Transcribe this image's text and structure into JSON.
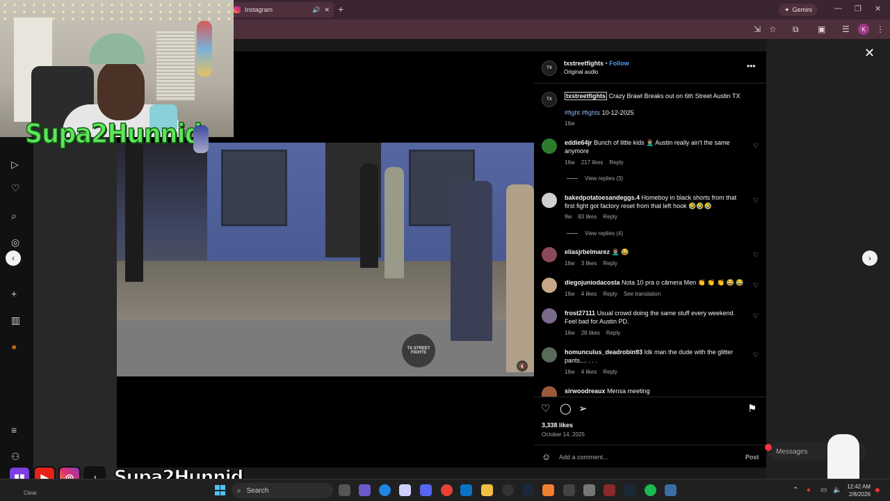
{
  "browser": {
    "tab_title": "Instagram",
    "new_tab": "+",
    "gemini_label": "Gemini",
    "profile_initial": "K",
    "window_controls": [
      "—",
      "❐",
      "✕"
    ]
  },
  "post": {
    "author": "txstreetfights",
    "follow_label": "Follow",
    "audio": "Original audio",
    "avatar_text": "TX",
    "caption_author": "txstreetfights",
    "caption_text": "Crazy Brawl Breaks out on 6th Street Austin TX",
    "hashtags": "#fight #fights",
    "caption_date": "10-12-2025",
    "caption_age": "16w",
    "video_logo_text": "TX STREET FIGHTS",
    "likes": "3,338 likes",
    "date": "October 14, 2025",
    "comment_placeholder": "Add a comment...",
    "post_label": "Post"
  },
  "comments": [
    {
      "user": "eddie64jr",
      "text": "Bunch of little kids 🤦🏽‍♂️ Austin really ain't the same anymore",
      "age": "16w",
      "likes": "217 likes",
      "reply": "Reply",
      "view_replies": "View replies (3)",
      "avatar_color": "#2e7a2e"
    },
    {
      "user": "bakedpotatoesandeggs.4",
      "text": "Homeboy in black shorts from that first fight got factory reset from that left hook 🤣🤣🤣",
      "age": "9w",
      "likes": "83 likes",
      "reply": "Reply",
      "view_replies": "View replies (4)",
      "avatar_color": "#cfcfcf"
    },
    {
      "user": "eliasjrbelmarez",
      "text": "🤦🏽‍♂️ 😂",
      "age": "16w",
      "likes": "3 likes",
      "reply": "Reply",
      "avatar_color": "#8a4a5a"
    },
    {
      "user": "diegojuniodacosta",
      "text": "Nota 10 pra o câmera Men 👏 👏 👏 😂 😂",
      "age": "16w",
      "likes": "4 likes",
      "reply": "Reply",
      "translate": "See translation",
      "avatar_color": "#c7a88a"
    },
    {
      "user": "frost27111",
      "text": "Usual crowd doing the same stuff every weekend. Feel bad for Austin PD.",
      "age": "16w",
      "likes": "28 likes",
      "reply": "Reply",
      "avatar_color": "#7a6a8a"
    },
    {
      "user": "homunculus_deadrobin93",
      "text": "Idk man the dude with the glitter pants.... . . .",
      "age": "16w",
      "likes": "4 likes",
      "reply": "Reply",
      "avatar_color": "#5a6a5a"
    },
    {
      "user": "sirwoodreaux",
      "text": "Mensa meeting",
      "avatar_color": "#9a5a3a"
    }
  ],
  "overlay": {
    "streamer_name": "Supa2Hunnid",
    "social_name": "Supa2Hunnid"
  },
  "messages_label": "Messages",
  "taskbar": {
    "search_placeholder": "Search",
    "time": "12:42 AM",
    "date": "2/8/2026",
    "clear_label": "Clear"
  }
}
